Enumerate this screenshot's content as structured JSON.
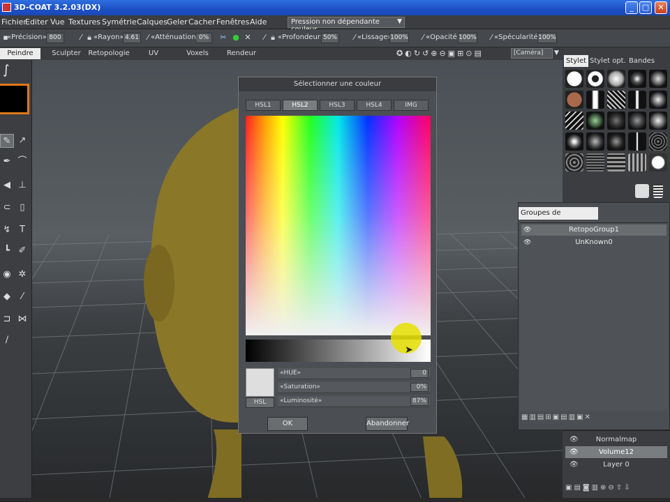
{
  "window": {
    "title": "3D-COAT 3.2.03(DX)"
  },
  "menu": {
    "items": [
      "Fichier",
      "Editer",
      "Vue",
      "Textures",
      "Symétrie",
      "Calques",
      "Geler",
      "Cacher",
      "Fenêtres",
      "Aide"
    ],
    "pressure_dropdown": "Pression non dépendante couleur"
  },
  "options": {
    "precision_label": "«Précision»",
    "precision_value": "800",
    "radius_label": "«Rayon»",
    "radius_value": "4.61",
    "attenuation_label": "«Atténuation»",
    "attenuation_value": "0%",
    "depth_label": "«Profondeur»",
    "depth_value": "50%",
    "smoothing_label": "«Lissage»",
    "smoothing_value": "100%",
    "opacity_label": "«Opacité»",
    "opacity_value": "100%",
    "specularity_label": "«Spécularité»",
    "specularity_value": "100%"
  },
  "modes": {
    "tabs": [
      "Peindre",
      "Sculpter",
      "Retopologie",
      "UV",
      "Voxels",
      "Rendeur"
    ],
    "active": "Peindre",
    "camera": "[Caméra]"
  },
  "left_toolbar": {
    "current_color": "#000000"
  },
  "color_dialog": {
    "title": "Sélectionner une couleur",
    "tabs": [
      "HSL1",
      "HSL2",
      "HSL3",
      "HSL4",
      "IMG"
    ],
    "active_tab": "HSL2",
    "mode_button": "HSL",
    "fields": [
      {
        "label": "«HUE»",
        "value": "0"
      },
      {
        "label": "«Saturation»",
        "value": "0%"
      },
      {
        "label": "«Luminosité»",
        "value": "87%"
      }
    ],
    "ok_label": "OK",
    "cancel_label": "Abandonner",
    "preview_color": "#dedede"
  },
  "brush_panel": {
    "tabs": [
      "Stylet",
      "Stylet opt.",
      "Bandes"
    ],
    "active_tab": "Stylet"
  },
  "retopo_panel": {
    "title": "Groupes de retopologie",
    "groups": [
      "RetopoGroup1",
      "UnKnown0"
    ]
  },
  "layers_panel": {
    "items": [
      "Normalmap",
      "Volume12",
      "Layer 0"
    ],
    "selected": "Volume12"
  },
  "colors": {
    "accent": "#e07818",
    "model": "#8c7a2a"
  }
}
